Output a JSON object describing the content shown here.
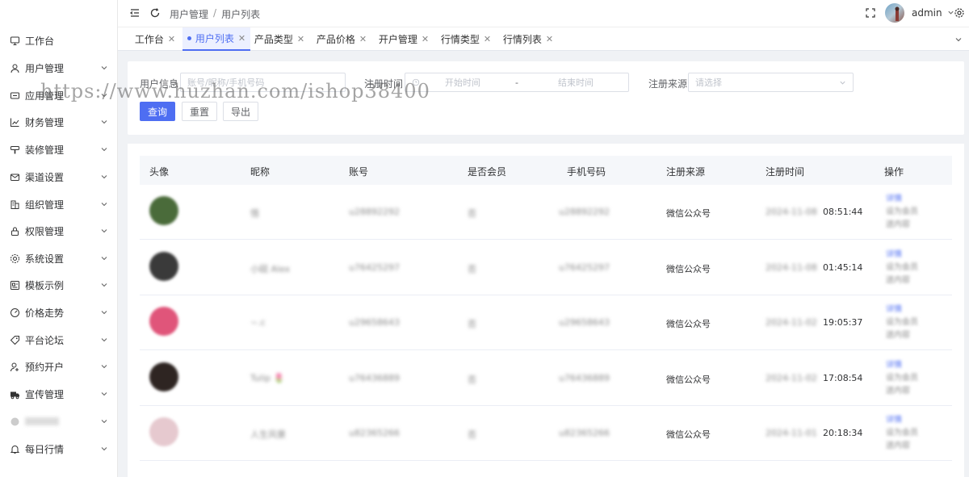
{
  "sidebar": {
    "items": [
      {
        "label": "工作台",
        "icon": "monitor-icon",
        "has_children": false
      },
      {
        "label": "用户管理",
        "icon": "user-icon",
        "has_children": true
      },
      {
        "label": "应用管理",
        "icon": "app-icon",
        "has_children": true
      },
      {
        "label": "财务管理",
        "icon": "chart-icon",
        "has_children": true
      },
      {
        "label": "装修管理",
        "icon": "brush-icon",
        "has_children": true
      },
      {
        "label": "渠道设置",
        "icon": "mail-icon",
        "has_children": true
      },
      {
        "label": "组织管理",
        "icon": "building-icon",
        "has_children": true
      },
      {
        "label": "权限管理",
        "icon": "lock-icon",
        "has_children": true
      },
      {
        "label": "系统设置",
        "icon": "gear-icon",
        "has_children": true
      },
      {
        "label": "模板示例",
        "icon": "template-icon",
        "has_children": true
      },
      {
        "label": "价格走势",
        "icon": "gauge-icon",
        "has_children": true
      },
      {
        "label": "平台论坛",
        "icon": "tag-icon",
        "has_children": true
      },
      {
        "label": "预约开户",
        "icon": "person-add-icon",
        "has_children": true
      },
      {
        "label": "宣传管理",
        "icon": "truck-icon",
        "has_children": true
      },
      {
        "label": "",
        "icon": "blurred-icon",
        "has_children": true
      },
      {
        "label": "每日行情",
        "icon": "bell-icon",
        "has_children": true
      }
    ]
  },
  "header": {
    "breadcrumb": [
      "用户管理",
      "用户列表"
    ],
    "breadcrumb_sep": "/",
    "username": "admin"
  },
  "tabs": [
    {
      "label": "工作台",
      "active": false
    },
    {
      "label": "用户列表",
      "active": true
    },
    {
      "label": "产品类型",
      "active": false
    },
    {
      "label": "产品价格",
      "active": false
    },
    {
      "label": "开户管理",
      "active": false
    },
    {
      "label": "行情类型",
      "active": false
    },
    {
      "label": "行情列表",
      "active": false
    }
  ],
  "search": {
    "user_info_label": "用户信息",
    "user_info_placeholder": "账号/昵称/手机号码",
    "reg_time_label": "注册时间",
    "start_placeholder": "开始时间",
    "range_sep": "-",
    "end_placeholder": "结束时间",
    "source_label": "注册来源",
    "source_placeholder": "请选择",
    "query_button": "查询",
    "reset_button": "重置",
    "export_button": "导出"
  },
  "table": {
    "columns": [
      "头像",
      "昵称",
      "账号",
      "是否会员",
      "手机号码",
      "注册来源",
      "注册时间",
      "操作"
    ],
    "rows": [
      {
        "avatar_color": "#4a6b3a",
        "nickname": "悟",
        "account": "u28892292",
        "member": "否",
        "phone": "u28892292",
        "source": "微信公众号",
        "date": "2024-11-08",
        "time": "08:51:44"
      },
      {
        "avatar_color": "#3a3a3a",
        "nickname": "小砚 Alex",
        "account": "u76425297",
        "member": "否",
        "phone": "u76425297",
        "source": "微信公众号",
        "date": "2024-11-08",
        "time": "01:45:14"
      },
      {
        "avatar_color": "#e0557a",
        "nickname": "~.c",
        "account": "u29658643",
        "member": "否",
        "phone": "u29658643",
        "source": "微信公众号",
        "date": "2024-11-02",
        "time": "19:05:37"
      },
      {
        "avatar_color": "#2e2522",
        "nickname": "Tulip 🌷",
        "account": "u76436889",
        "member": "否",
        "phone": "u76436889",
        "source": "微信公众号",
        "date": "2024-11-02",
        "time": "17:08:54"
      },
      {
        "avatar_color": "#e6c9cf",
        "nickname": "人生风景",
        "account": "u82365266",
        "member": "否",
        "phone": "u82365266",
        "source": "微信公众号",
        "date": "2024-11-01",
        "time": "20:18:34"
      }
    ],
    "ops": {
      "detail": "详情",
      "set_member": "设为会员",
      "coupon": "送内容"
    }
  },
  "watermark": "https://www.huzhan.com/ishop38400"
}
